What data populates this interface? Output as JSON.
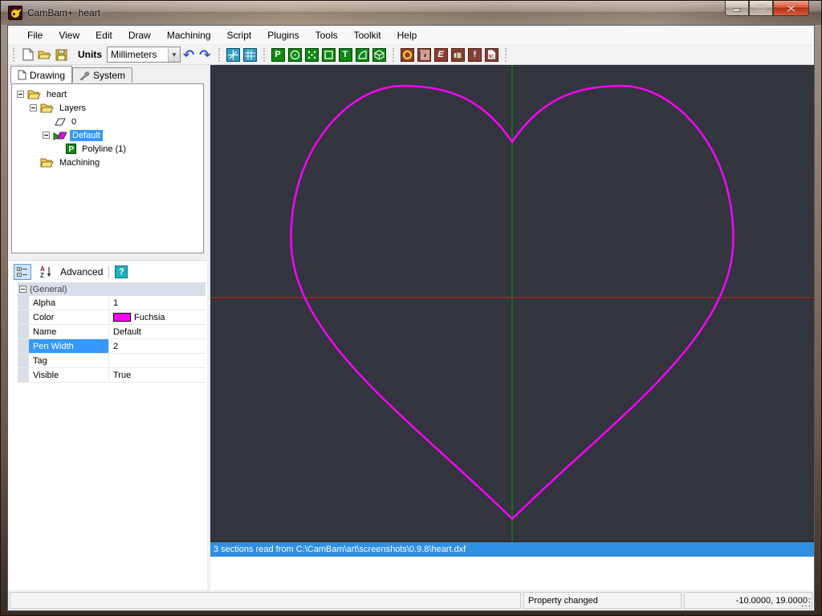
{
  "window": {
    "title": "CamBam+  heart",
    "controls": {
      "minimize": "minimize",
      "maximize": "maximize",
      "close": "close"
    }
  },
  "menu": {
    "items": [
      "File",
      "View",
      "Edit",
      "Draw",
      "Machining",
      "Script",
      "Plugins",
      "Tools",
      "Toolkit",
      "Help"
    ]
  },
  "toolbar": {
    "units_label": "Units",
    "units_value": "Millimeters",
    "undo_glyph": "↶",
    "redo_glyph": "↷",
    "glyphs": {
      "polyline": "P",
      "text": "T",
      "engrave": "E",
      "gcode": "NC"
    },
    "icons": [
      "new-file",
      "open-file",
      "save-file",
      "undo",
      "redo",
      "toggle-axes",
      "toggle-grid",
      "draw-polyline",
      "draw-circle",
      "draw-points",
      "draw-rectangle",
      "draw-text",
      "draw-arc",
      "draw-surface",
      "machine-profile",
      "machine-pocket",
      "machine-engrave",
      "machine-lathe",
      "machine-drill",
      "produce-gcode"
    ]
  },
  "sidebar": {
    "tabs": [
      {
        "label": "Drawing"
      },
      {
        "label": "System"
      }
    ],
    "tree": {
      "items": [
        {
          "label": "heart"
        },
        {
          "label": "Layers"
        },
        {
          "label": "0"
        },
        {
          "label": "Default"
        },
        {
          "label": "Polyline (1)"
        },
        {
          "label": "Machining"
        }
      ],
      "polyline_glyph": "P"
    }
  },
  "properties": {
    "toolbar": {
      "advanced_label": "Advanced",
      "help_label": "?",
      "sort_a": "A",
      "sort_z": "Z"
    },
    "category": "(General)",
    "rows": [
      {
        "name": "Alpha",
        "value": "1"
      },
      {
        "name": "Color",
        "value": "Fuchsia",
        "swatch": "#ff00ff"
      },
      {
        "name": "Name",
        "value": "Default"
      },
      {
        "name": "Pen Width",
        "value": "2"
      },
      {
        "name": "Tag",
        "value": ""
      },
      {
        "name": "Visible",
        "value": "True"
      }
    ],
    "selected_row": "Pen Width"
  },
  "canvas": {
    "background": "#32343e",
    "x_axis_color": "#e01313",
    "y_axis_color": "#00a000",
    "heart_color": "#ff00ff",
    "pen_width": "2.5"
  },
  "log": {
    "message": "3 sections read from C:\\CamBam\\art\\screenshots\\0.9.8\\heart.dxf"
  },
  "statusbar": {
    "message": "Property changed",
    "coords": "-10.0000, 19.0000"
  }
}
